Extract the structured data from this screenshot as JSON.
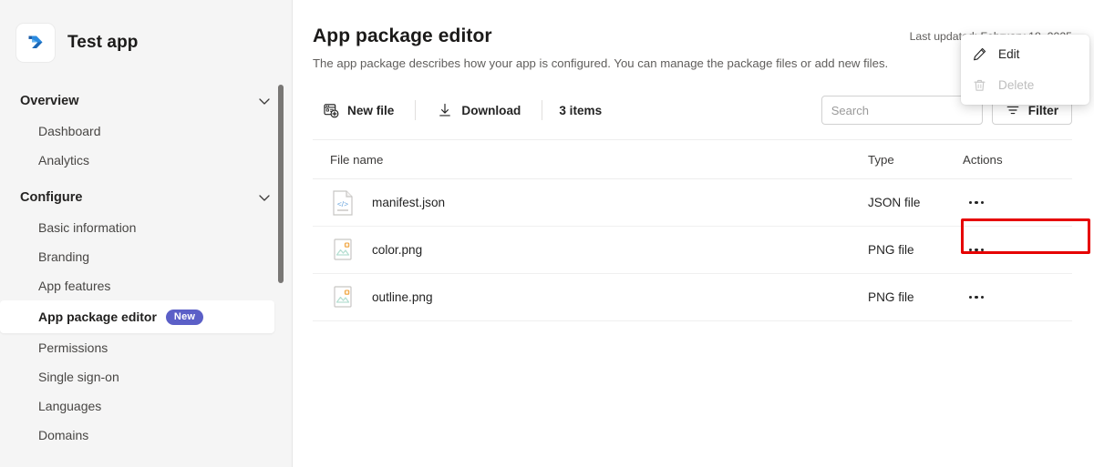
{
  "sidebar": {
    "brand": {
      "name": "Test app",
      "logo_icon": "power-automate-logo"
    },
    "groups": [
      {
        "label": "Overview",
        "chevron_icon": "chevron-down-icon",
        "items": [
          {
            "label": "Dashboard",
            "selected": false
          },
          {
            "label": "Analytics",
            "selected": false
          }
        ]
      },
      {
        "label": "Configure",
        "chevron_icon": "chevron-down-icon",
        "items": [
          {
            "label": "Basic information",
            "selected": false
          },
          {
            "label": "Branding",
            "selected": false
          },
          {
            "label": "App features",
            "selected": false
          },
          {
            "label": "App package editor",
            "selected": true,
            "badge": "New"
          },
          {
            "label": "Permissions",
            "selected": false
          },
          {
            "label": "Single sign-on",
            "selected": false
          },
          {
            "label": "Languages",
            "selected": false
          },
          {
            "label": "Domains",
            "selected": false
          }
        ]
      }
    ],
    "badge_color": "#5b5fc7"
  },
  "main": {
    "title": "App package editor",
    "description": "The app package describes how your app is configured. You can manage the package files or add new files.",
    "last_updated": "Last updated: February 18, 2025",
    "toolbar": {
      "new_file_label": "New file",
      "new_file_icon": "new-file-icon",
      "download_label": "Download",
      "download_icon": "download-icon",
      "item_count": "3 items",
      "search_placeholder": "Search",
      "search_value": "",
      "filter_label": "Filter",
      "filter_icon": "filter-icon"
    },
    "table": {
      "columns": [
        "File name",
        "Type",
        "Actions"
      ],
      "rows": [
        {
          "name": "manifest.json",
          "type": "JSON file",
          "icon": "json-file-icon",
          "actions_icon": "more-options-icon"
        },
        {
          "name": "color.png",
          "type": "PNG file",
          "icon": "image-file-icon",
          "actions_icon": "more-options-icon"
        },
        {
          "name": "outline.png",
          "type": "PNG file",
          "icon": "image-file-icon",
          "actions_icon": "more-options-icon"
        }
      ]
    },
    "context_menu": {
      "items": [
        {
          "label": "Edit",
          "icon": "pencil-icon",
          "disabled": false,
          "highlighted": true
        },
        {
          "label": "Delete",
          "icon": "trash-icon",
          "disabled": true,
          "highlighted": false
        }
      ],
      "highlight_color": "#e60000"
    }
  }
}
